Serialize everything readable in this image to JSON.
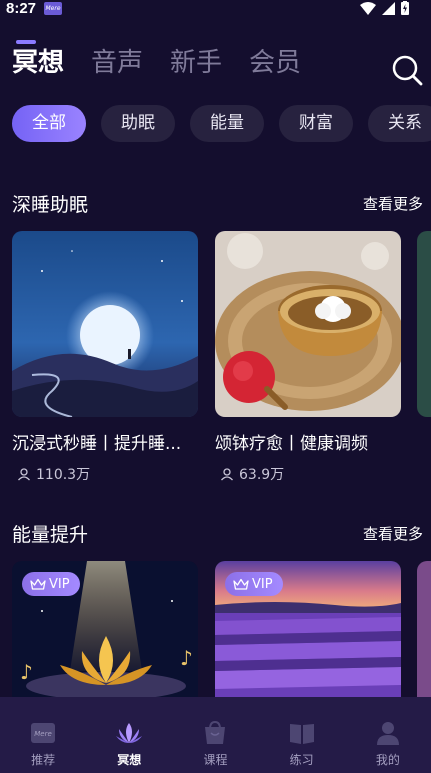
{
  "status": {
    "time": "8:27",
    "app_icon_label": "Mere"
  },
  "top_tabs": [
    {
      "label": "冥想"
    },
    {
      "label": "音声"
    },
    {
      "label": "新手"
    },
    {
      "label": "会员"
    }
  ],
  "chips": [
    {
      "label": "全部"
    },
    {
      "label": "助眠"
    },
    {
      "label": "能量"
    },
    {
      "label": "财富"
    },
    {
      "label": "关系"
    }
  ],
  "sections": [
    {
      "title": "深睡助眠",
      "more": "查看更多",
      "cards": [
        {
          "title": "沉浸式秒睡丨提升睡...",
          "plays": "110.3万"
        },
        {
          "title": "颂钵疗愈丨健康调频",
          "plays": "63.9万"
        }
      ]
    },
    {
      "title": "能量提升",
      "more": "查看更多",
      "cards": [
        {
          "badge": "VIP"
        },
        {
          "badge": "VIP"
        }
      ]
    }
  ],
  "bottom_nav": [
    {
      "label": "推荐",
      "icon": "mere-logo-icon",
      "icon_text": "Mere"
    },
    {
      "label": "冥想",
      "icon": "lotus-icon"
    },
    {
      "label": "课程",
      "icon": "bag-icon"
    },
    {
      "label": "练习",
      "icon": "book-icon"
    },
    {
      "label": "我的",
      "icon": "user-icon"
    }
  ],
  "colors": {
    "background": "#140e2e",
    "accent": "#8b7bff",
    "nav_background": "#241b47"
  }
}
